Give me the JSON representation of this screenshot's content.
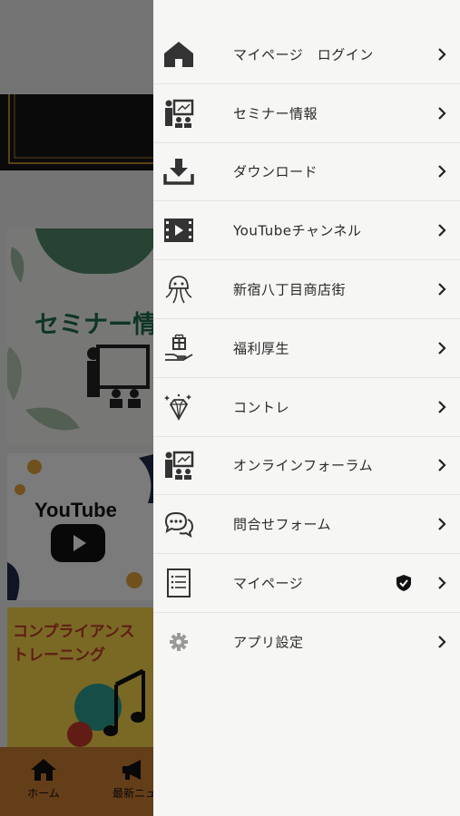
{
  "background_app": {
    "seminar_title": "セミナー情",
    "youtube_title": "YouTube",
    "compliance_line1": "コンプライアンス",
    "compliance_line2": "トレーニング",
    "tabs": [
      {
        "label": "ホーム",
        "icon": "home-icon"
      },
      {
        "label": "最新ニュ",
        "icon": "megaphone-icon"
      }
    ]
  },
  "drawer": {
    "items": [
      {
        "label": "マイページ　ログイン",
        "icon": "home-icon"
      },
      {
        "label": "セミナー情報",
        "icon": "presenter-icon"
      },
      {
        "label": "ダウンロード",
        "icon": "download-icon"
      },
      {
        "label": "YouTubeチャンネル",
        "icon": "film-play-icon"
      },
      {
        "label": "新宿八丁目商店街",
        "icon": "jellyfish-icon"
      },
      {
        "label": "福利厚生",
        "icon": "gift-hand-icon"
      },
      {
        "label": "コントレ",
        "icon": "diamond-icon"
      },
      {
        "label": "オンラインフォーラム",
        "icon": "presenter-icon"
      },
      {
        "label": "問合せフォーム",
        "icon": "chat-bubbles-icon"
      },
      {
        "label": "マイページ",
        "icon": "document-list-icon",
        "badge": "shield-check-icon"
      },
      {
        "label": "アプリ設定",
        "icon": "gear-icon"
      }
    ]
  },
  "colors": {
    "drawer_bg": "#f6f6f4",
    "icon": "#333333",
    "divider": "#e4e4e2"
  }
}
